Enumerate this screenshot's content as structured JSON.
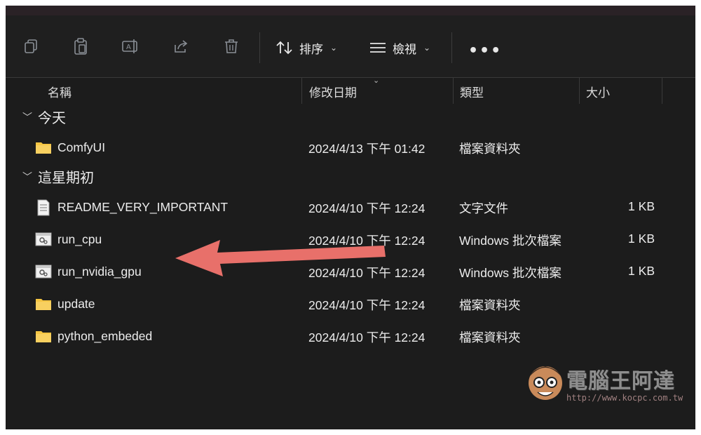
{
  "toolbar": {
    "copy_icon": "copy-icon",
    "paste_icon": "clipboard-icon",
    "rename_icon": "rename-icon",
    "share_icon": "share-icon",
    "delete_icon": "trash-icon",
    "sort_label": "排序",
    "view_label": "檢視",
    "more_label": "•••"
  },
  "columns": {
    "name": "名稱",
    "modified": "修改日期",
    "type": "類型",
    "size": "大小"
  },
  "groups": [
    {
      "label": "今天",
      "items": [
        {
          "name": "ComfyUI",
          "date": "2024/4/13 下午 01:42",
          "type": "檔案資料夾",
          "size": "",
          "icon": "folder-icon"
        }
      ]
    },
    {
      "label": "這星期初",
      "items": [
        {
          "name": "README_VERY_IMPORTANT",
          "date": "2024/4/10 下午 12:24",
          "type": "文字文件",
          "size": "1 KB",
          "icon": "text-file-icon"
        },
        {
          "name": "run_cpu",
          "date": "2024/4/10 下午 12:24",
          "type": "Windows 批次檔案",
          "size": "1 KB",
          "icon": "batch-file-icon"
        },
        {
          "name": "run_nvidia_gpu",
          "date": "2024/4/10 下午 12:24",
          "type": "Windows 批次檔案",
          "size": "1 KB",
          "icon": "batch-file-icon"
        },
        {
          "name": "update",
          "date": "2024/4/10 下午 12:24",
          "type": "檔案資料夾",
          "size": "",
          "icon": "folder-icon"
        },
        {
          "name": "python_embeded",
          "date": "2024/4/10 下午 12:24",
          "type": "檔案資料夾",
          "size": "",
          "icon": "folder-icon"
        }
      ]
    }
  ],
  "watermark": {
    "text": "電腦王阿達",
    "url": "http://www.kocpc.com.tw"
  },
  "colors": {
    "background": "#1c1c1c",
    "annotation_arrow": "#e8706a",
    "folder": "#f5c542"
  }
}
